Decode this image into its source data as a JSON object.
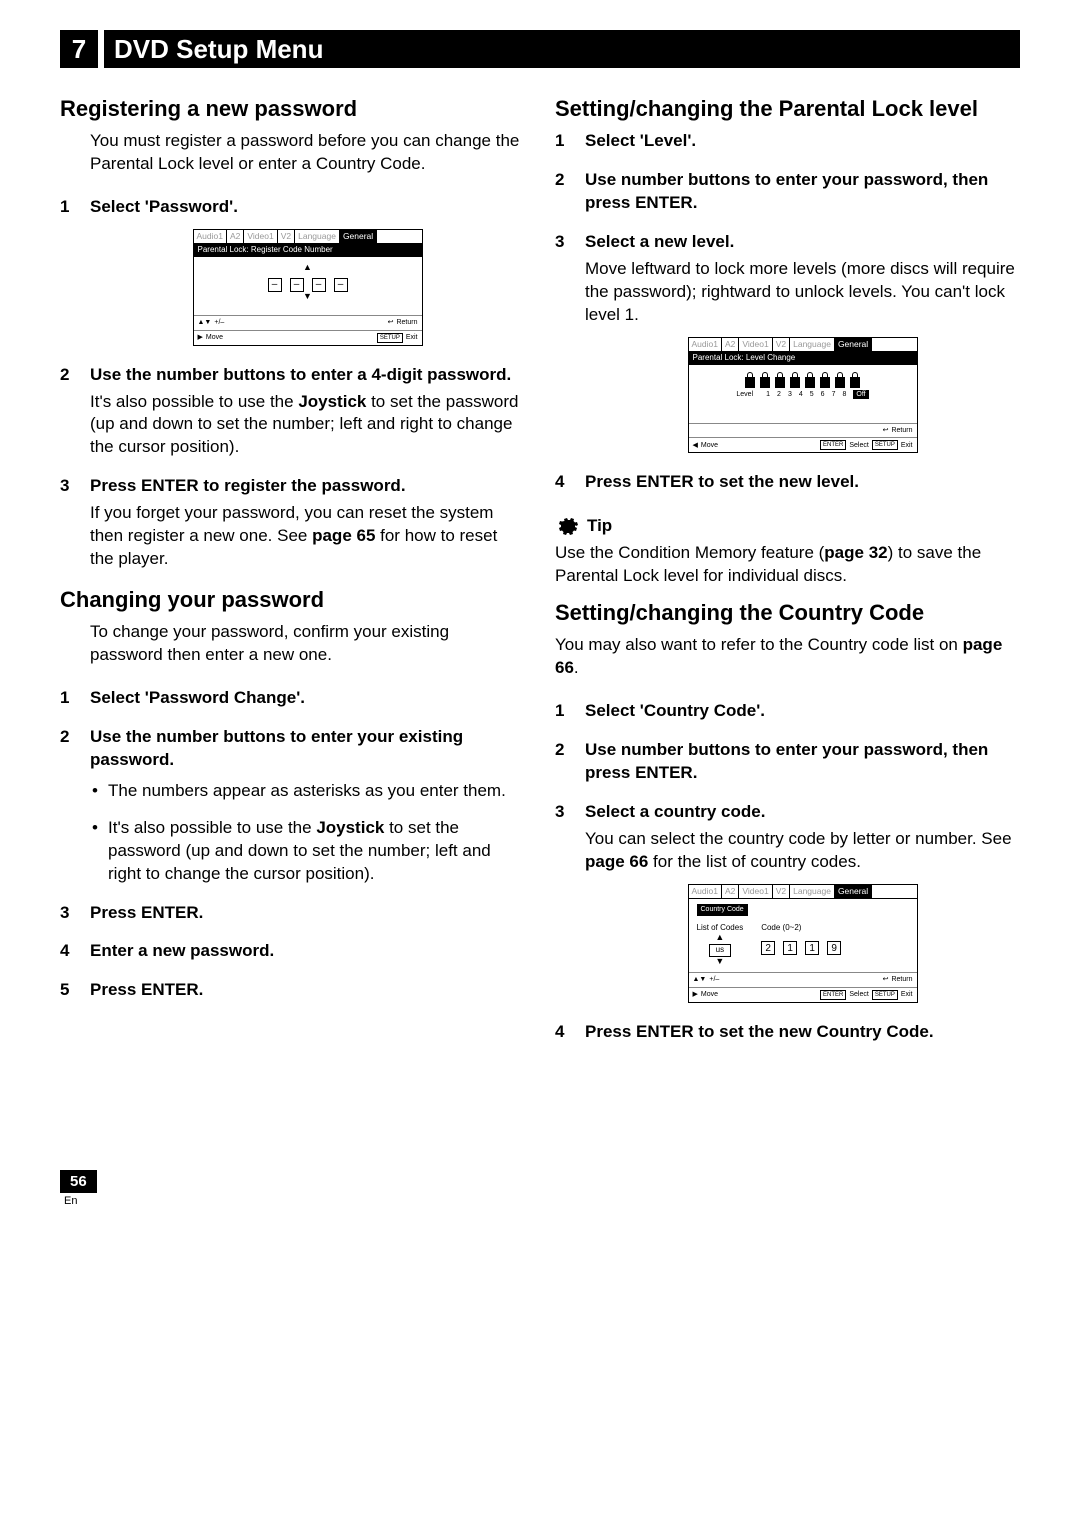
{
  "chapter": {
    "number": "7",
    "title": "DVD Setup Menu"
  },
  "osd": {
    "tabs": [
      "Audio1",
      "A2",
      "Video1",
      "V2",
      "Language",
      "General"
    ],
    "pw_title": "Parental Lock: Register Code Number",
    "level_title": "Parental Lock: Level Change",
    "cc_title": "Country Code",
    "move": "Move",
    "plusminus": "+/–",
    "return": "Return",
    "exit": "Exit",
    "enter": "ENTER",
    "select": "Select",
    "setup": "SETUP",
    "level_label": "Level",
    "level_nums": [
      "1",
      "2",
      "3",
      "4",
      "5",
      "6",
      "7",
      "8"
    ],
    "off": "Off",
    "dash": "–",
    "cc_list": "List of Codes",
    "cc_code_label": "Code (0~2)",
    "cc_us": "us",
    "cc_digits": [
      "2",
      "1",
      "1",
      "9"
    ]
  },
  "left": {
    "h1": "Registering a new password",
    "intro1": "You must register a password before you can change the Parental Lock level or enter a Country Code.",
    "s1_head": "Select 'Password'.",
    "s2_head": "Use the number buttons to enter a 4-digit password.",
    "s2_body_a": "It's also possible to use the ",
    "s2_body_bold": "Joystick",
    "s2_body_b": " to set the password (up and down to set the number; left and right to change the cursor position).",
    "s3_head": "Press ENTER to register the password.",
    "s3_body_a": "If you forget your password, you can reset the system then register a new one. See ",
    "s3_body_bold": "page 65",
    "s3_body_b": " for how to reset the player.",
    "h2": "Changing your password",
    "intro2": "To change your password, confirm your existing password then enter a new one.",
    "c1_head": "Select 'Password Change'.",
    "c2_head": "Use the number buttons to enter your existing password.",
    "c2_b1": "The numbers appear as asterisks as you enter them.",
    "c2_b2_a": "It's also possible to use the ",
    "c2_b2_bold": "Joystick",
    "c2_b2_b": " to set the password (up and down to set the number; left and right to change the cursor position).",
    "c3_head": "Press ENTER.",
    "c4_head": "Enter a new password.",
    "c5_head": "Press ENTER."
  },
  "right": {
    "h1": "Setting/changing the Parental Lock level",
    "l1_head": "Select 'Level'.",
    "l2_head": "Use number buttons to enter your password, then press ENTER.",
    "l3_head": "Select a new level.",
    "l3_body": "Move leftward to lock more levels (more discs will require the password); rightward to unlock levels. You can't lock level 1.",
    "l4_head": "Press ENTER to set the new level.",
    "tip_label": "Tip",
    "tip_a": "Use the Condition Memory feature (",
    "tip_bold": "page 32",
    "tip_b": ") to save the Parental Lock level for individual discs.",
    "h2": "Setting/changing the Country Code",
    "cc_intro_a": "You may also want to refer to the Country code list on ",
    "cc_intro_bold": "page 66",
    "cc_intro_b": ".",
    "cc1_head": "Select 'Country Code'.",
    "cc2_head": "Use number buttons to enter your password, then press ENTER.",
    "cc3_head": "Select a country code.",
    "cc3_body_a": "You can select the country code by letter or number. See ",
    "cc3_body_bold": "page 66",
    "cc3_body_b": " for the list of country codes.",
    "cc4_head": "Press ENTER to set the new Country Code."
  },
  "footer": {
    "page": "56",
    "lang": "En"
  }
}
